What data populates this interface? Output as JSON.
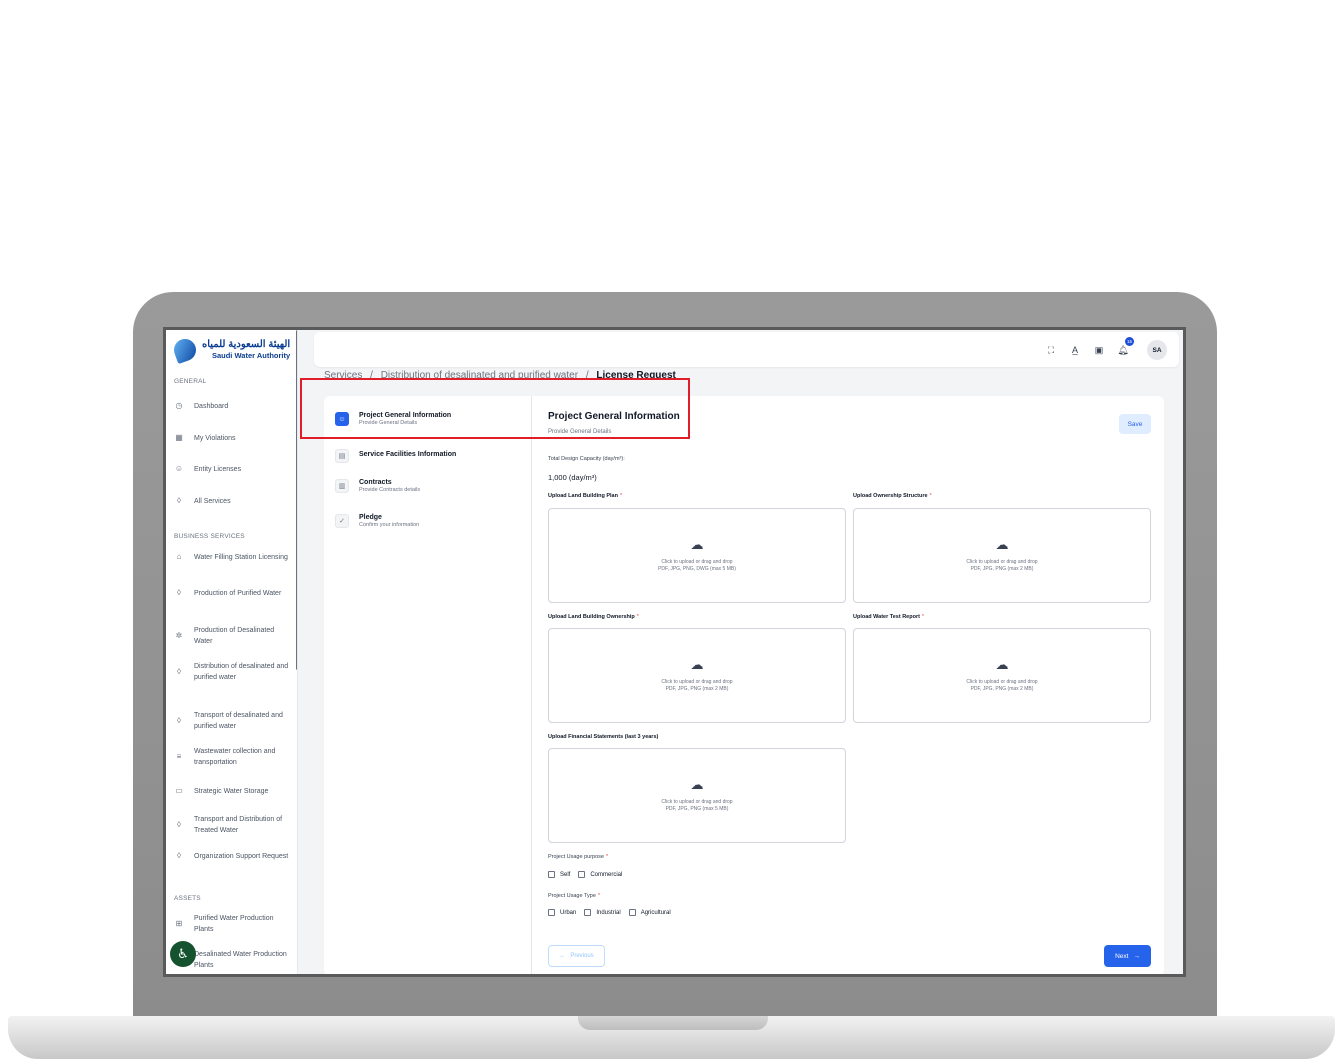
{
  "brand": {
    "name_ar": "الهيئة السعودية للمياه",
    "name_en": "Saudi Water Authority"
  },
  "sidebar": {
    "sections": [
      "GENERAL",
      "BUSINESS SERVICES",
      "ASSETS"
    ],
    "general": [
      {
        "label": "Dashboard",
        "icon": "gauge-icon"
      },
      {
        "label": "My Violations",
        "icon": "grid-icon"
      },
      {
        "label": "Entity Licenses",
        "icon": "user-icon"
      },
      {
        "label": "All Services",
        "icon": "drop-icon"
      }
    ],
    "business": [
      {
        "label": "Water Filling Station Licensing",
        "icon": "station-icon"
      },
      {
        "label": "Production of Purified Water",
        "icon": "drop-icon"
      },
      {
        "label": "Production of Desalinated Water",
        "icon": "sun-icon"
      },
      {
        "label": "Distribution of desalinated and purified water",
        "icon": "drop-icon"
      },
      {
        "label": "Transport of desalinated and purified water",
        "icon": "drop-icon"
      },
      {
        "label": "Wastewater collection and transportation",
        "icon": "lines-icon"
      },
      {
        "label": "Strategic Water Storage",
        "icon": "storage-icon"
      },
      {
        "label": "Transport and Distribution of Treated Water",
        "icon": "drop-icon"
      },
      {
        "label": "Organization Support Request",
        "icon": "drop-icon"
      }
    ],
    "assets": [
      {
        "label": "Purified Water Production Plants",
        "icon": "table-icon"
      },
      {
        "label": "Desalinated Water Production Plants",
        "icon": "table-icon"
      }
    ]
  },
  "topbar": {
    "notification_count": "15",
    "avatar_initials": "SA"
  },
  "breadcrumb": {
    "items": [
      "Services",
      "Distribution of desalinated and purified water",
      "License Request"
    ],
    "separator": "/"
  },
  "steps": [
    {
      "title": "Project General Information",
      "subtitle": "Provide General Details",
      "active": true
    },
    {
      "title": "Service Facilities Information",
      "subtitle": "",
      "active": false
    },
    {
      "title": "Contracts",
      "subtitle": "Provide Contracts details",
      "active": false
    },
    {
      "title": "Pledge",
      "subtitle": "Confirm your information",
      "active": false
    }
  ],
  "form": {
    "title": "Project General Information",
    "subtitle": "Provide General Details",
    "save_label": "Save",
    "capacity_label": "Total Design Capacity (day/m³):",
    "capacity_value": "1,000 (day/m³)",
    "upload_hint": "Click to upload or drag and drop",
    "uploads": [
      {
        "label": "Upload Land Building Plan",
        "required": "*",
        "formats": "PDF, JPG, PNG, DWG (max 5 MB)"
      },
      {
        "label": "Upload Ownership Structure",
        "required": "*",
        "formats": "PDF, JPG, PNG (max 2 MB)"
      },
      {
        "label": "Upload Land Building Ownership",
        "required": "*",
        "formats": "PDF, JPG, PNG (max 2 MB)"
      },
      {
        "label": "Upload Water Test Report",
        "required": "*",
        "formats": "PDF, JPG, PNG (max 2 MB)"
      },
      {
        "label": "Upload Financial Statements (last 3 years)",
        "required": "",
        "formats": "PDF, JPG, PNG (max 5 MB)"
      }
    ],
    "usage_purpose_label": "Project Usage purpose",
    "usage_purpose_options": [
      "Self",
      "Commercial"
    ],
    "usage_type_label": "Project Usage Type",
    "usage_type_options": [
      "Urban",
      "Industrial",
      "Agricultural"
    ],
    "required_mark": "*",
    "previous_label": "Previous",
    "next_label": "Next"
  },
  "colors": {
    "primary": "#2563eb",
    "highlight": "#e11d2a",
    "accessibility_button": "#14532d"
  }
}
